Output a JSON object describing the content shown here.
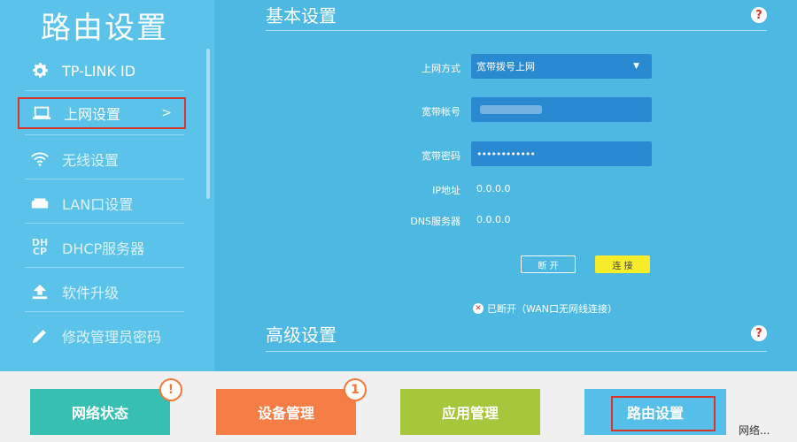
{
  "sidebar": {
    "title": "路由设置",
    "items": [
      {
        "label": "TP-LINK ID",
        "icon": "gear-icon"
      },
      {
        "label": "上网设置",
        "icon": "laptop-icon",
        "arrow": ">"
      },
      {
        "label": "无线设置",
        "icon": "wifi-icon"
      },
      {
        "label": "LAN口设置",
        "icon": "lan-icon"
      },
      {
        "label": "DHCP服务器",
        "icon": "dhcp-icon",
        "icon_text": "DH\nCP"
      },
      {
        "label": "软件升级",
        "icon": "upload-icon"
      },
      {
        "label": "修改管理员密码",
        "icon": "pencil-icon"
      }
    ]
  },
  "main": {
    "basic_title": "基本设置",
    "advanced_title": "高级设置",
    "help_glyph": "?",
    "fields": {
      "conn_type_label": "上网方式",
      "conn_type_value": "宽带拨号上网",
      "account_label": "宽带帐号",
      "password_label": "宽带密码",
      "password_value": "••••••••••••",
      "ip_label": "IP地址",
      "ip_value": "0.0.0.0",
      "dns_label": "DNS服务器",
      "dns_value": "0.0.0.0"
    },
    "disconnect_label": "断 开",
    "connect_label": "连 接",
    "status_text": "已断开（WAN口无网线连接）"
  },
  "tiles": [
    {
      "label": "网络状态",
      "color": "#37c0b2",
      "badge": "!"
    },
    {
      "label": "设备管理",
      "color": "#f47e45",
      "badge": "1"
    },
    {
      "label": "应用管理",
      "color": "#a6c63c"
    },
    {
      "label": "路由设置",
      "color": "#56bfe9"
    }
  ],
  "corner_text": "网络..."
}
